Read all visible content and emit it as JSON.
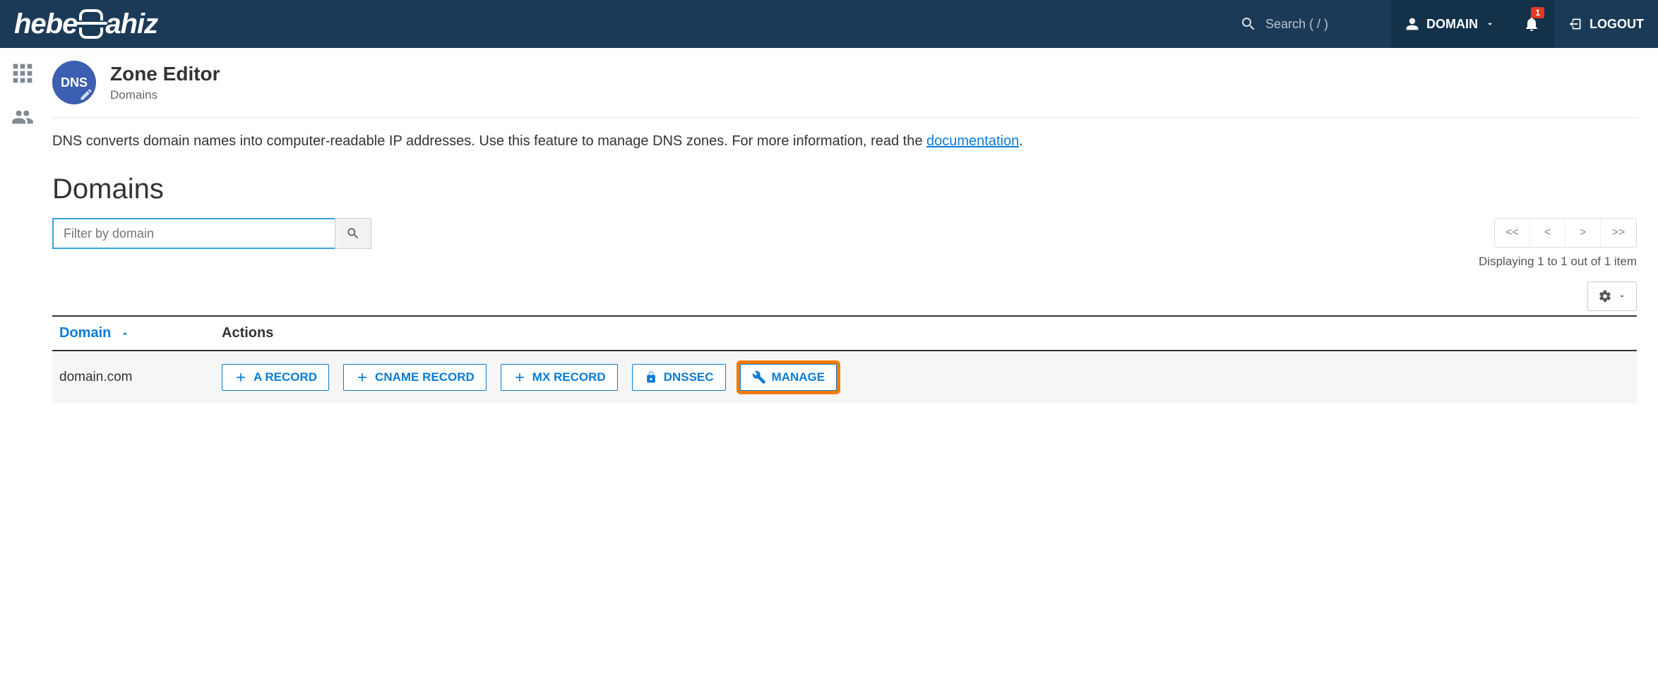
{
  "topbar": {
    "logo_left": "hebe",
    "logo_right": "ahiz",
    "search_placeholder": "Search ( / )",
    "user_label": "DOMAIN",
    "notifications_count": "1",
    "logout_label": "LOGOUT"
  },
  "page": {
    "title": "Zone Editor",
    "subtitle": "Domains",
    "badge_text": "DNS",
    "description_pre": "DNS converts domain names into computer-readable IP addresses. Use this feature to manage DNS zones. For more information, read the ",
    "description_link": "documentation",
    "description_post": "."
  },
  "section_heading": "Domains",
  "filter": {
    "placeholder": "Filter by domain"
  },
  "pager": {
    "first": "<<",
    "prev": "<",
    "next": ">",
    "last": ">>",
    "status": "Displaying 1 to 1 out of 1 item"
  },
  "table": {
    "col_domain": "Domain",
    "col_actions": "Actions",
    "rows": [
      {
        "domain": "domain.com",
        "a_record": "A RECORD",
        "cname_record": "CNAME RECORD",
        "mx_record": "MX RECORD",
        "dnssec": "DNSSEC",
        "manage": "MANAGE"
      }
    ]
  }
}
